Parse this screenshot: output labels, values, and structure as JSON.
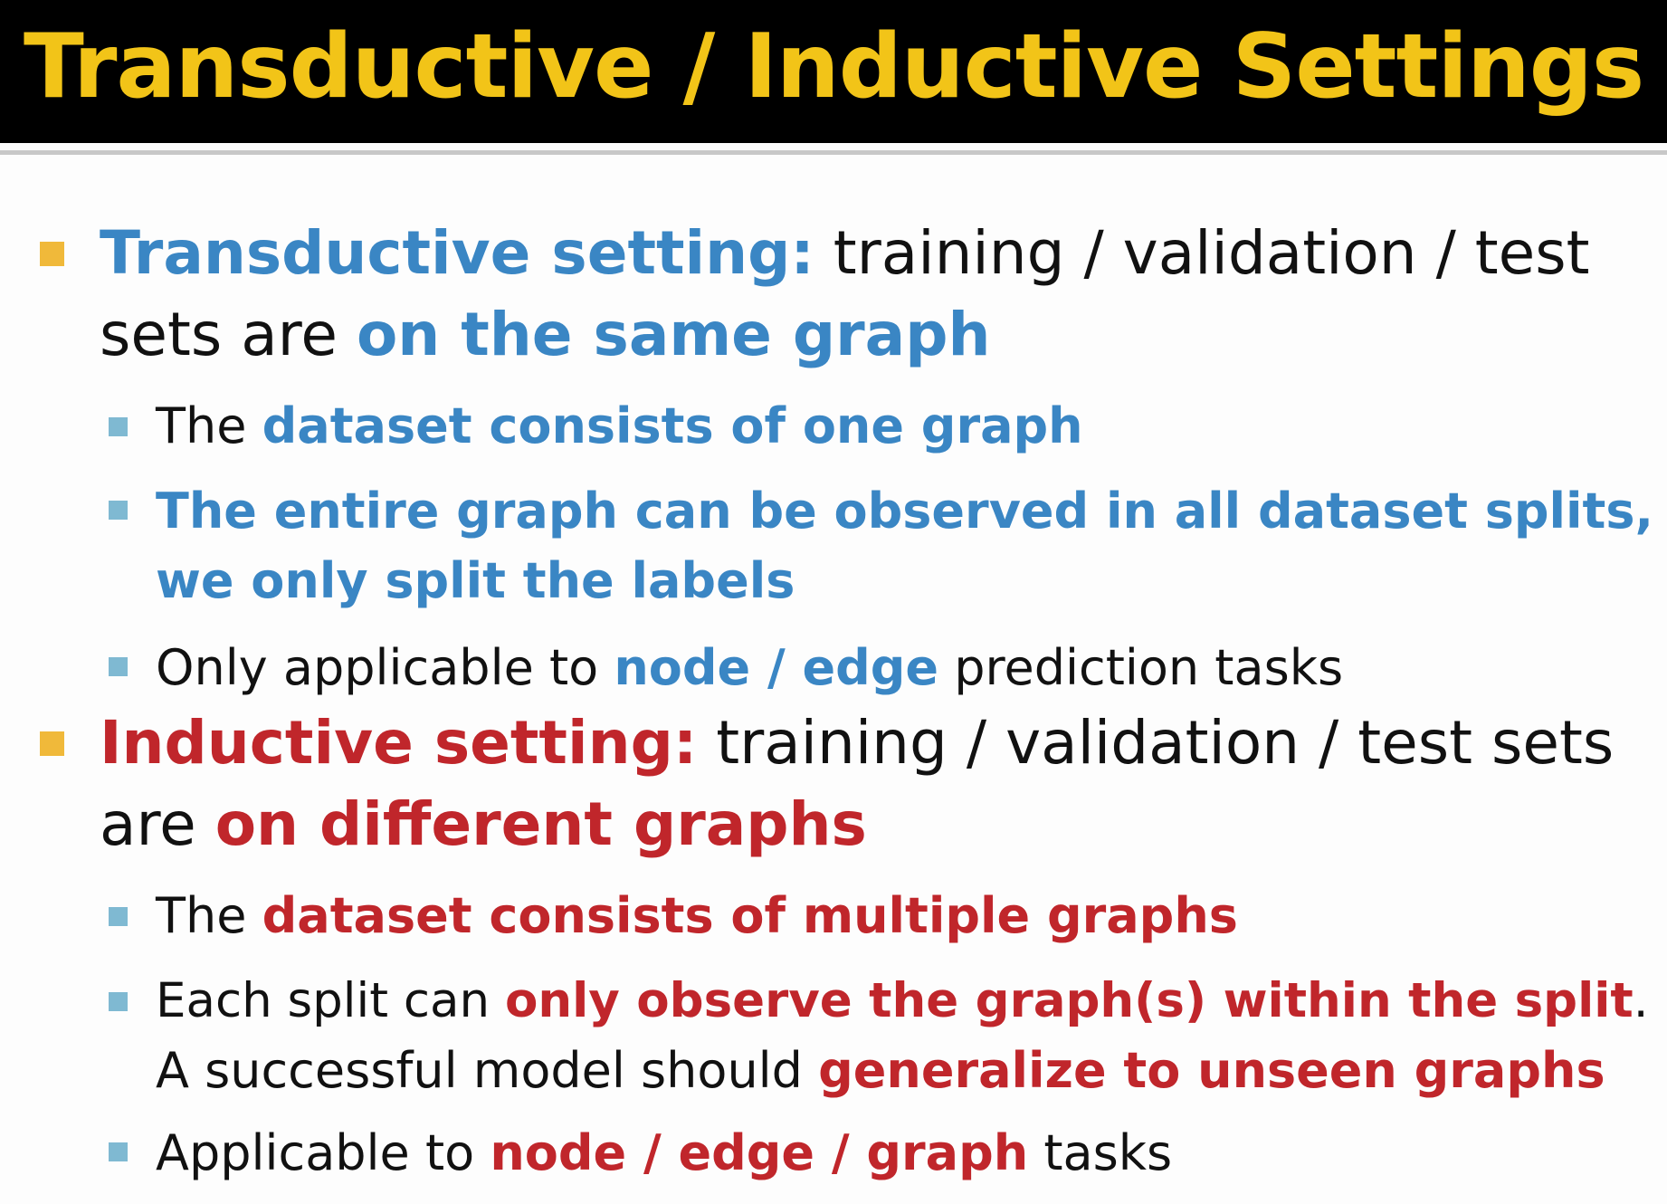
{
  "slide": {
    "title": "Transductive / Inductive Settings"
  },
  "colors": {
    "title_yellow": "#f2c418",
    "blue_accent": "#3a86c4",
    "red_accent": "#c0262b",
    "level1_bullet": "#f0b93a",
    "level2_bullet": "#7fb9d2",
    "body_text": "#111111"
  },
  "bullets": [
    {
      "level": 1,
      "lines": [
        [
          {
            "text": "Transductive setting:",
            "style": "blue-bold"
          },
          {
            "text": " training / validation / test",
            "style": "plain"
          }
        ],
        [
          {
            "text": "sets are ",
            "style": "plain"
          },
          {
            "text": "on the same graph",
            "style": "blue-bold"
          }
        ]
      ]
    },
    {
      "level": 2,
      "lines": [
        [
          {
            "text": "The ",
            "style": "plain"
          },
          {
            "text": "dataset consists of one graph",
            "style": "blue-bold"
          }
        ]
      ]
    },
    {
      "level": 2,
      "lines": [
        [
          {
            "text": "The entire graph can be observed in all dataset splits,",
            "style": "blue-bold"
          }
        ],
        [
          {
            "text": "we only split the labels",
            "style": "blue-bold"
          }
        ]
      ]
    },
    {
      "level": 2,
      "lines": [
        [
          {
            "text": "Only applicable to ",
            "style": "plain"
          },
          {
            "text": "node / edge",
            "style": "blue-bold"
          },
          {
            "text": " prediction tasks",
            "style": "plain"
          }
        ]
      ]
    },
    {
      "level": 1,
      "lines": [
        [
          {
            "text": "Inductive setting:",
            "style": "red-bold"
          },
          {
            "text": " training / validation / test sets",
            "style": "plain"
          }
        ],
        [
          {
            "text": "are ",
            "style": "plain"
          },
          {
            "text": "on different graphs",
            "style": "red-bold"
          }
        ]
      ]
    },
    {
      "level": 2,
      "lines": [
        [
          {
            "text": "The ",
            "style": "plain"
          },
          {
            "text": "dataset consists of multiple graphs",
            "style": "red-bold"
          }
        ]
      ]
    },
    {
      "level": 2,
      "lines": [
        [
          {
            "text": "Each split can ",
            "style": "plain"
          },
          {
            "text": "only observe the graph(s) within the split",
            "style": "red-bold"
          },
          {
            "text": ".",
            "style": "plain"
          }
        ],
        [
          {
            "text": "A successful model should ",
            "style": "plain"
          },
          {
            "text": "generalize to unseen graphs",
            "style": "red-bold"
          }
        ]
      ]
    },
    {
      "level": 2,
      "lines": [
        [
          {
            "text": "Applicable to ",
            "style": "plain"
          },
          {
            "text": "node / edge / graph",
            "style": "red-bold"
          },
          {
            "text": " tasks",
            "style": "plain"
          }
        ]
      ]
    }
  ]
}
